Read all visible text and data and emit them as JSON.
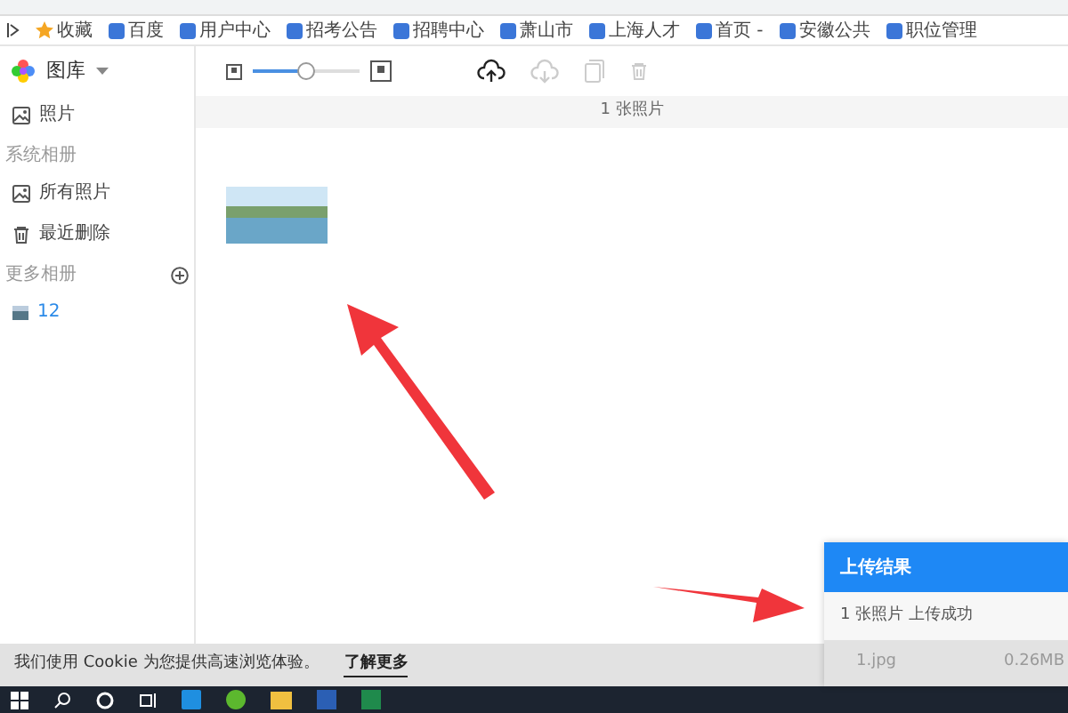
{
  "bookmarks": [
    {
      "label": "收藏",
      "kind": "star"
    },
    {
      "label": "百度",
      "kind": "site"
    },
    {
      "label": "用户中心",
      "kind": "site"
    },
    {
      "label": "招考公告",
      "kind": "site"
    },
    {
      "label": "招聘中心",
      "kind": "site"
    },
    {
      "label": "萧山市",
      "kind": "site"
    },
    {
      "label": "上海人才",
      "kind": "site"
    },
    {
      "label": "首页 -",
      "kind": "site"
    },
    {
      "label": "安徽公共",
      "kind": "site"
    },
    {
      "label": "职位管理",
      "kind": "site"
    }
  ],
  "app": {
    "title": "图库"
  },
  "sidebar": [
    {
      "kind": "item",
      "label": "照片",
      "selected": false
    },
    {
      "kind": "header",
      "label": "系统相册"
    },
    {
      "kind": "item",
      "label": "所有照片",
      "selected": false
    },
    {
      "kind": "item",
      "label": "最近删除",
      "selected": false
    },
    {
      "kind": "header",
      "label": "更多相册",
      "add": true
    },
    {
      "kind": "album",
      "label": "12",
      "selected": true
    }
  ],
  "toolbar": {
    "size_slider": {
      "level": 0.5
    },
    "buttons": [
      {
        "disabled": false
      },
      {
        "disabled": true
      },
      {
        "disabled": true
      },
      {
        "disabled": true
      }
    ]
  },
  "photo_count": "1 张照片",
  "upload_panel": {
    "title": "上传结果",
    "summary": "1 张照片 上传成功",
    "files": [
      {
        "name": "1.jpg",
        "size": "0.26MB"
      }
    ]
  },
  "cookie_bar": {
    "text": "我们使用 Cookie 为您提供高速浏览体验。",
    "link": "了解更多"
  }
}
